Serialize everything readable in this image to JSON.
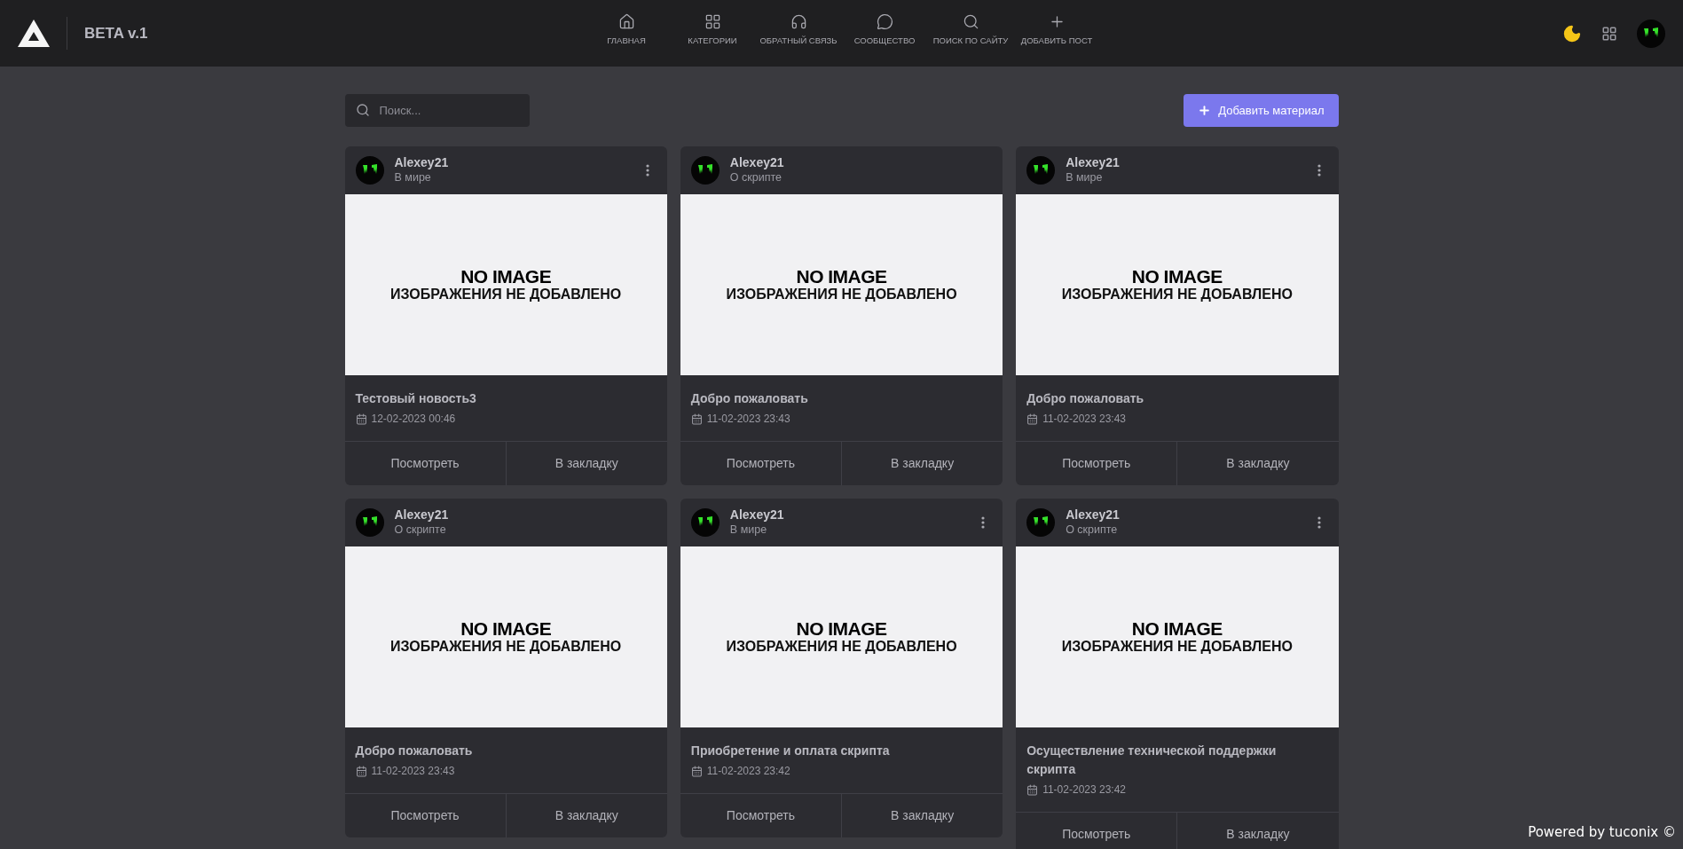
{
  "header": {
    "brand": "BETA v.1",
    "nav": [
      {
        "kind": "home",
        "label": "ГЛАВНАЯ"
      },
      {
        "kind": "grid",
        "label": "КАТЕГОРИИ"
      },
      {
        "kind": "headphones",
        "label": "ОБРАТНЫЙ СВЯЗЬ"
      },
      {
        "kind": "chat",
        "label": "СООБЩЕСТВО"
      },
      {
        "kind": "search",
        "label": "ПОИСК ПО САЙТУ"
      },
      {
        "kind": "plus",
        "label": "ДОБАВИТЬ ПОСТ"
      }
    ]
  },
  "search": {
    "placeholder": "Поиск..."
  },
  "add_button": "Добавить материал",
  "posts": [
    {
      "author": "Alexey21",
      "category": "В мире",
      "menu": true,
      "image_title": "NO IMAGE",
      "image_subtitle": "ИЗОБРАЖЕНИЯ НЕ ДОБАВЛЕНО",
      "title": "Тестовый новость3",
      "date": "12-02-2023 00:46",
      "actions": [
        "Посмотреть",
        "В закладку"
      ]
    },
    {
      "author": "Alexey21",
      "category": "О скрипте",
      "menu": false,
      "image_title": "NO IMAGE",
      "image_subtitle": "ИЗОБРАЖЕНИЯ НЕ ДОБАВЛЕНО",
      "title": "Добро пожаловать",
      "date": "11-02-2023 23:43",
      "actions": [
        "Посмотреть",
        "В закладку"
      ]
    },
    {
      "author": "Alexey21",
      "category": "В мире",
      "menu": true,
      "image_title": "NO IMAGE",
      "image_subtitle": "ИЗОБРАЖЕНИЯ НЕ ДОБАВЛЕНО",
      "title": "Добро пожаловать",
      "date": "11-02-2023 23:43",
      "actions": [
        "Посмотреть",
        "В закладку"
      ]
    },
    {
      "author": "Alexey21",
      "category": "О скрипте",
      "menu": false,
      "image_title": "NO IMAGE",
      "image_subtitle": "ИЗОБРАЖЕНИЯ НЕ ДОБАВЛЕНО",
      "title": "Добро пожаловать",
      "date": "11-02-2023 23:43",
      "actions": [
        "Посмотреть",
        "В закладку"
      ]
    },
    {
      "author": "Alexey21",
      "category": "В мире",
      "menu": true,
      "image_title": "NO IMAGE",
      "image_subtitle": "ИЗОБРАЖЕНИЯ НЕ ДОБАВЛЕНО",
      "title": "Приобретение и оплата скрипта",
      "date": "11-02-2023 23:42",
      "actions": [
        "Посмотреть",
        "В закладку"
      ]
    },
    {
      "author": "Alexey21",
      "category": "О скрипте",
      "menu": true,
      "image_title": "NO IMAGE",
      "image_subtitle": "ИЗОБРАЖЕНИЯ НЕ ДОБАВЛЕНО",
      "title": "Осуществление технической поддержки скрипта",
      "date": "11-02-2023 23:42",
      "actions": [
        "Посмотреть",
        "В закладку"
      ]
    }
  ],
  "footer": "Powered by tuconix ©"
}
